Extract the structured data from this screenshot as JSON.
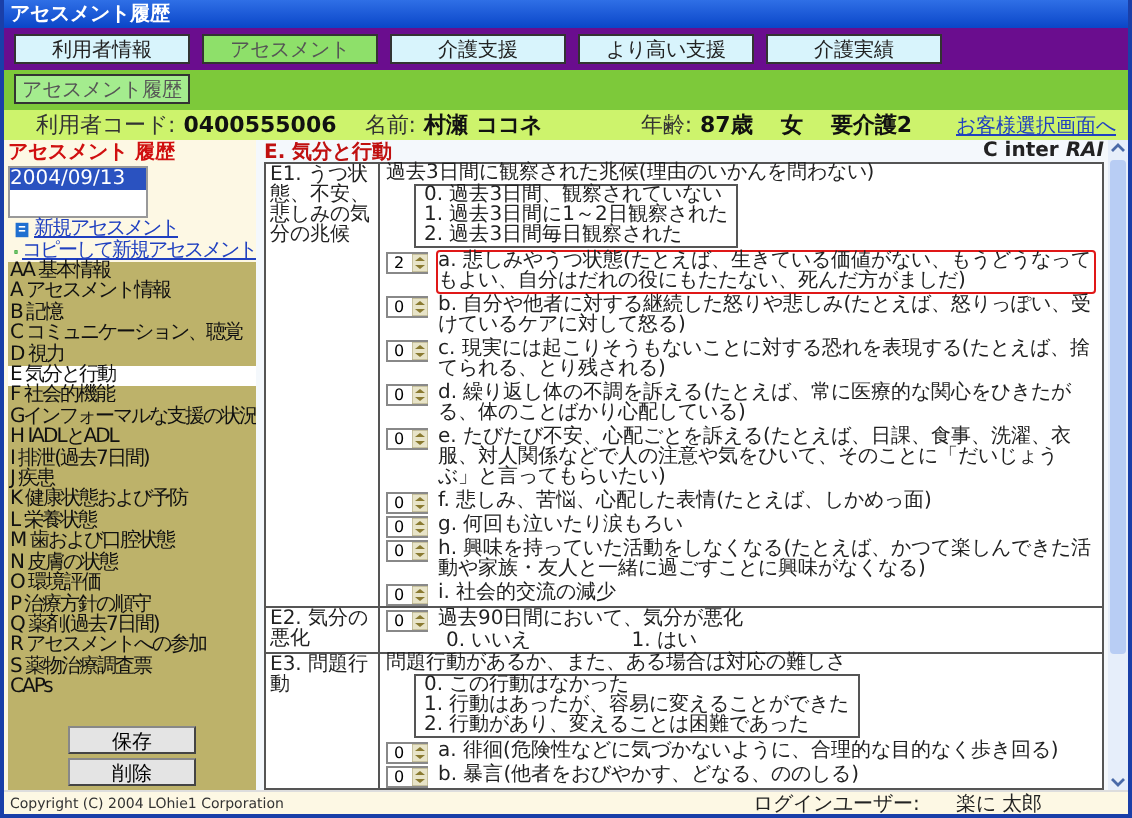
{
  "window": {
    "title": "アセスメント履歴"
  },
  "nav_tabs": [
    {
      "label": "利用者情報",
      "selected": false
    },
    {
      "label": "アセスメント",
      "selected": true
    },
    {
      "label": "介護支援",
      "selected": false
    },
    {
      "label": "より高い支援",
      "selected": false
    },
    {
      "label": "介護実績",
      "selected": false
    }
  ],
  "sub_button": "アセスメント履歴",
  "client": {
    "code_label": "利用者コード:",
    "code": "0400555006",
    "name_label": "名前:",
    "name": "村瀬 ココネ",
    "age_label": "年齢:",
    "age": "87歳",
    "sex": "女",
    "care_level": "要介護2",
    "link": "お客様選択画面へ"
  },
  "sidebar": {
    "heading": "アセスメント 履歴",
    "dates": [
      {
        "label": "2004/09/13",
        "selected": true
      }
    ],
    "links": [
      "新規アセスメント",
      "コピーして新規アセスメント"
    ],
    "items": [
      {
        "label": "AA 基本情報",
        "selected": false
      },
      {
        "label": "A アセスメント情報",
        "selected": false
      },
      {
        "label": "B 記憶",
        "selected": false
      },
      {
        "label": "C コミュニケーション、聴覚",
        "selected": false
      },
      {
        "label": "D 視力",
        "selected": false
      },
      {
        "label": "E 気分と行動",
        "selected": true
      },
      {
        "label": "F 社会的機能",
        "selected": false
      },
      {
        "label": "Gインフォーマルな支援の状況",
        "selected": false
      },
      {
        "label": "H IADLとADL",
        "selected": false
      },
      {
        "label": "I 排泄(過去7日間)",
        "selected": false
      },
      {
        "label": "J 疾患",
        "selected": false
      },
      {
        "label": "K 健康状態および予防",
        "selected": false
      },
      {
        "label": "L 栄養状態",
        "selected": false
      },
      {
        "label": "M 歯および口腔状態",
        "selected": false
      },
      {
        "label": "N 皮膚の状態",
        "selected": false
      },
      {
        "label": "O 環境評価",
        "selected": false
      },
      {
        "label": "P 治療方針の順守",
        "selected": false
      },
      {
        "label": "Q 薬剤(過去7日間)",
        "selected": false
      },
      {
        "label": "R アセスメントへの参加",
        "selected": false
      },
      {
        "label": "S 薬物治療調査票",
        "selected": false
      },
      {
        "label": "CAPs",
        "selected": false
      }
    ],
    "buttons": [
      "保存",
      "削除"
    ],
    "copyright": "Copyright (C) 2004 LOhie1 Corporation"
  },
  "section": {
    "title": "E. 気分と行動",
    "logo": "C inter *RAI*",
    "questions": [
      {
        "label": "E1. うつ状態、不安、悲しみの気分の兆候",
        "header": "過去3日間に観察された兆候(理由のいかんを問わない)",
        "scale": [
          "0. 過去3日間、観察されていない",
          "1. 過去3日間に1～2日観察された",
          "2. 過去3日間毎日観察された"
        ],
        "items": [
          {
            "value": "2",
            "text": "a. 悲しみやうつ状態(たとえば、生きている価値がない、もうどうなってもよい、自分はだれの役にもたたない、死んだ方がましだ)",
            "highlighted": true
          },
          {
            "value": "0",
            "text": "b. 自分や他者に対する継続した怒りや悲しみ(たとえば、怒りっぽい、受けているケアに対して怒る)",
            "highlighted": false
          },
          {
            "value": "0",
            "text": "c. 現実には起こりそうもないことに対する恐れを表現する(たとえば、捨てられる、とり残される)",
            "highlighted": false
          },
          {
            "value": "0",
            "text": "d. 繰り返し体の不調を訴える(たとえば、常に医療的な関心をひきたがる、体のことばかり心配している)",
            "highlighted": false
          },
          {
            "value": "0",
            "text": "e. たびたび不安、心配ごとを訴える(たとえば、日課、食事、洗濯、衣服、対人関係などで人の注意や気をひいて、そのことに「だいじょうぶ」と言ってもらいたい)",
            "highlighted": false
          },
          {
            "value": "0",
            "text": "f. 悲しみ、苦悩、心配した表情(たとえば、しかめっ面)",
            "highlighted": false
          },
          {
            "value": "0",
            "text": "g. 何回も泣いたり涙もろい",
            "highlighted": false
          },
          {
            "value": "0",
            "text": "h. 興味を持っていた活動をしなくなる(たとえば、かつて楽しんできた活動や家族・友人と一緒に過ごすことに興味がなくなる)",
            "highlighted": false
          },
          {
            "value": "0",
            "text": "i. 社会的交流の減少",
            "highlighted": false
          }
        ]
      },
      {
        "label": "E2. 気分の悪化",
        "items": [
          {
            "value": "0",
            "text": "過去90日間において、気分が悪化",
            "highlighted": false
          }
        ],
        "options": [
          "0. いいえ",
          "1. はい"
        ]
      },
      {
        "label": "E3. 問題行動",
        "header": "問題行動があるか、また、ある場合は対応の難しさ",
        "scale": [
          "0. この行動はなかった",
          "1. 行動はあったが、容易に変えることができた",
          "2. 行動があり、変えることは困難であった"
        ],
        "items": [
          {
            "value": "0",
            "text": "a. 徘徊(危険性などに気づかないように、合理的な目的なく歩き回る)",
            "highlighted": false
          },
          {
            "value": "0",
            "text": "b. 暴言(他者をおびやかす、どなる、ののしる)",
            "highlighted": false
          }
        ]
      }
    ]
  },
  "status_bar": {
    "user_label": "ログインユーザー:",
    "user": "楽に 太郎"
  }
}
